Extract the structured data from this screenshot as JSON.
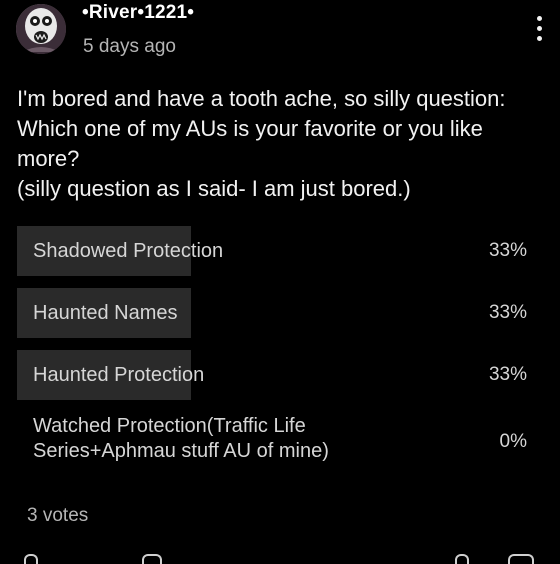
{
  "post": {
    "author": "•River•1221•",
    "timestamp": "5 days ago",
    "body_lines": [
      "I'm bored and have a tooth ache, so silly question:",
      "Which one of my AUs is your favorite or you like",
      "more?",
      "(silly question as I said- I am just bored.)"
    ]
  },
  "poll": {
    "options": [
      {
        "label": "Shadowed Protection",
        "percent_text": "33%",
        "percent": 33
      },
      {
        "label": "Haunted Names",
        "percent_text": "33%",
        "percent": 33
      },
      {
        "label": "Haunted Protection",
        "percent_text": "33%",
        "percent": 33
      },
      {
        "label": "Watched Protection(Traffic Life Series+Aphmau stuff AU of mine)",
        "percent_text": "0%",
        "percent": 0
      }
    ],
    "votes": "3 votes"
  },
  "icons": {
    "menu": "more-vert-icon",
    "avatar": "avatar-image"
  },
  "colors": {
    "background": "#000000",
    "poll_fill": "#2a2a2a",
    "text_primary": "#f2f2f2",
    "text_secondary": "#b5b5b5"
  }
}
